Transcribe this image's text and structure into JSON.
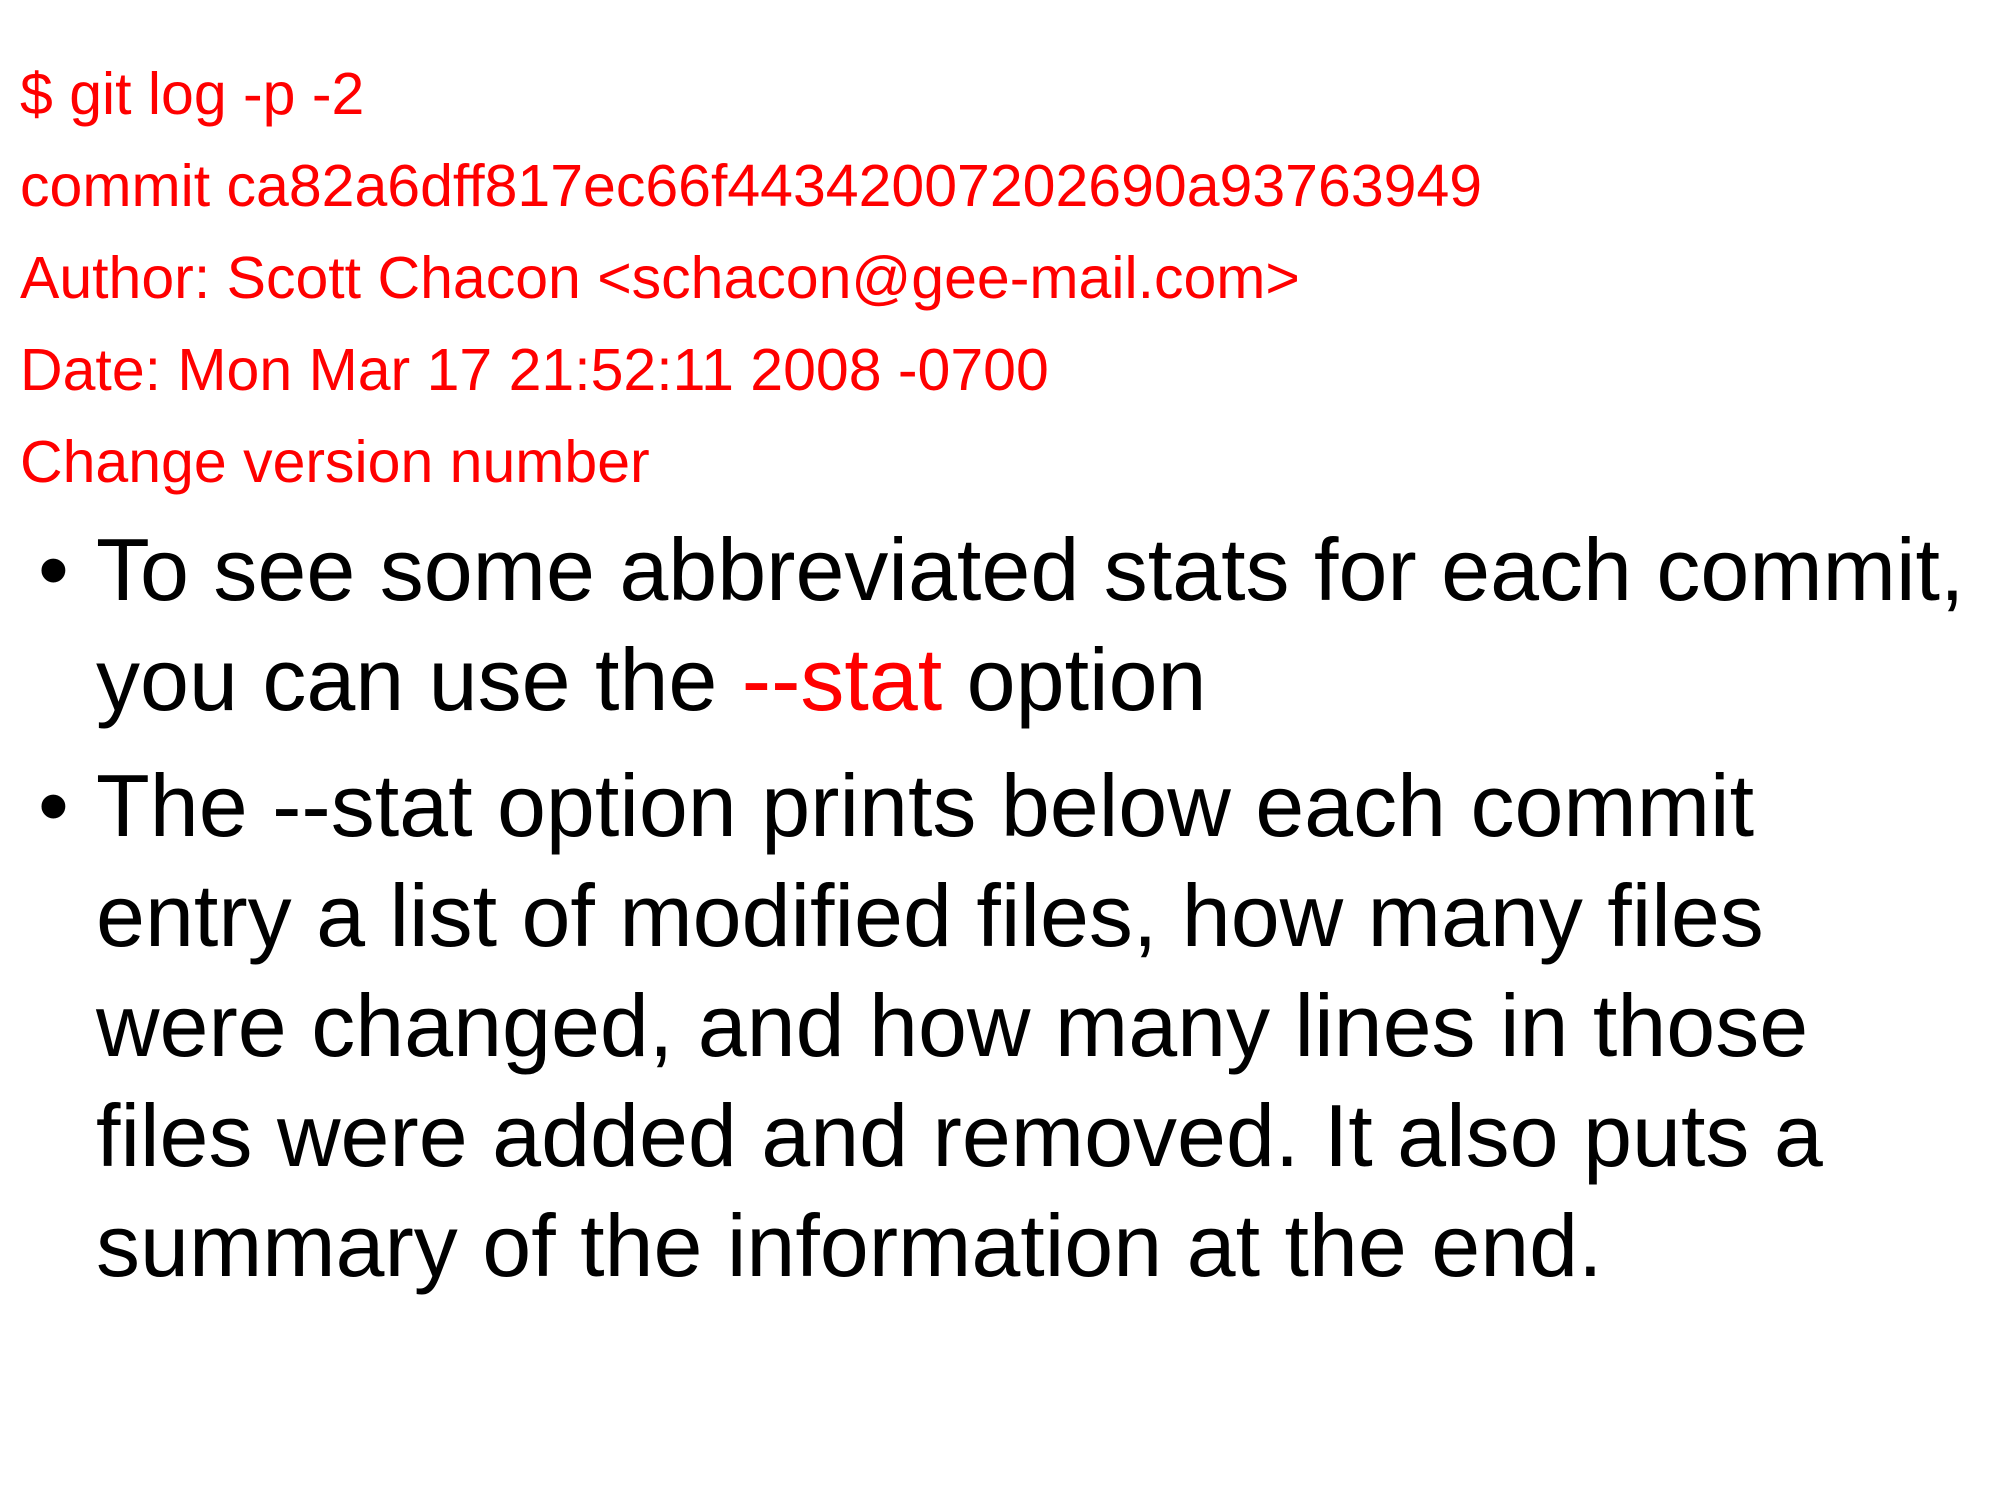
{
  "colors": {
    "code_text": "#ff0000",
    "body_text": "#000000",
    "highlight": "#ff0000",
    "background": "#ffffff"
  },
  "code_lines": [
    "$ git log -p -2",
    "commit ca82a6dff817ec66f44342007202690a93763949",
    "Author: Scott Chacon <schacon@gee-mail.com>",
    "Date: Mon Mar 17 21:52:11 2008 -0700",
    "Change version number"
  ],
  "bullets": {
    "marker": "•",
    "item1": {
      "before": "To see some abbreviated stats for each commit, you can use the ",
      "highlight": "--stat",
      "after": " option"
    },
    "item2": {
      "text": "The --stat option prints below each commit entry a list of modified files, how many files were changed, and how many lines in those files were added and removed. It also puts a summary of the information at the end."
    }
  }
}
